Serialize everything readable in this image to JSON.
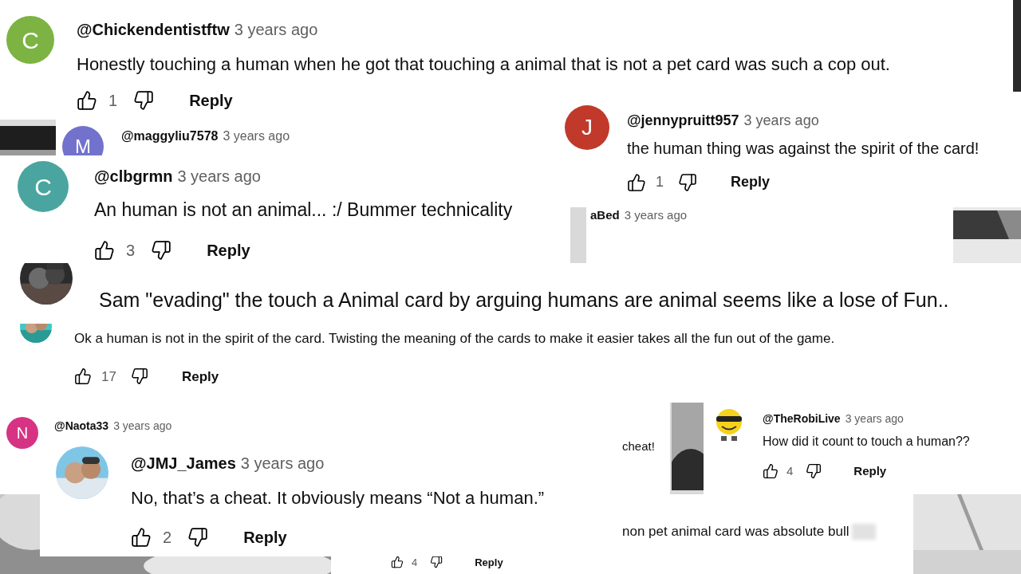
{
  "comments": [
    {
      "avatar": {
        "letter": "C",
        "color": "#7cb342"
      },
      "handle": "@Chickendentistftw",
      "time": "3 years ago",
      "text": "Honestly touching a human when he got that touching a animal that is not a pet card was such a cop out.",
      "likes": "1",
      "reply": "Reply"
    },
    {
      "avatar": {
        "letter": "M",
        "color": "#7272cc"
      },
      "handle": "@maggyliu7578",
      "time": "3 years ago"
    },
    {
      "avatar": {
        "letter": "J",
        "color": "#c0392b"
      },
      "handle": "@jennypruitt957",
      "time": "3 years ago",
      "text": "the human thing was against the spirit of the card!",
      "likes": "1",
      "reply": "Reply"
    },
    {
      "avatar": {
        "letter": "C",
        "color": "#4aa5a0"
      },
      "handle": "@clbgrmn",
      "time": "3 years ago",
      "text": "An human is not an animal... :/ Bummer technicality",
      "likes": "3",
      "reply": "Reply"
    },
    {
      "handle": "aBed",
      "time": "3 years ago"
    },
    {
      "text": "Sam \"evading\" the touch a Animal card by arguing humans are animal seems like a lose of Fun.."
    },
    {
      "text": "Ok a human is not in the spirit of the card. Twisting the meaning of the cards to make it easier takes all the fun out of the game.",
      "likes": "17",
      "reply": "Reply"
    },
    {
      "avatar": {
        "letter": "N",
        "color": "#d63384"
      },
      "handle": "@Naota33",
      "time": "3 years ago"
    },
    {
      "text": "cheat!"
    },
    {
      "text": "non pet animal card was absolute bull",
      "likes": "4",
      "reply": "Reply"
    },
    {
      "avatar": {
        "kind": "drawing"
      },
      "handle": "@TheRobiLive",
      "time": "3 years ago",
      "text": "How did it count to touch a human??",
      "likes": "4",
      "reply": "Reply"
    },
    {
      "handle": "@JMJ_James",
      "time": "3 years ago",
      "text": "No, that’s a cheat. It obviously means “Not a human.”",
      "likes": "2",
      "reply": "Reply"
    }
  ]
}
